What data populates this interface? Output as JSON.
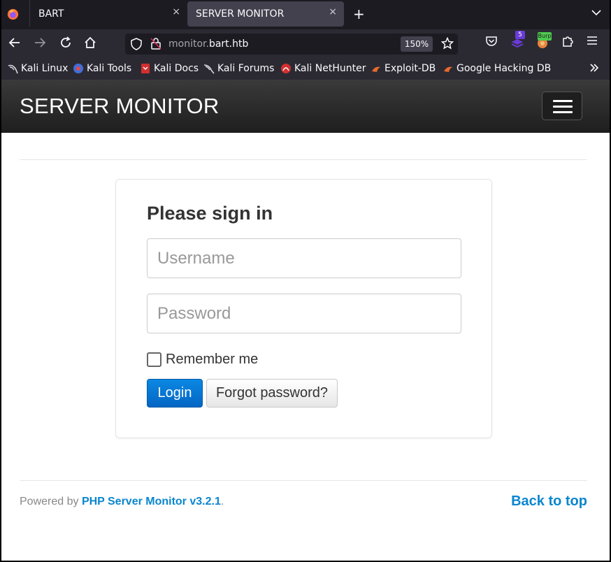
{
  "browser": {
    "tabs": [
      {
        "label": "BART",
        "close": "×"
      },
      {
        "label": "SERVER MONITOR",
        "close": "×"
      }
    ],
    "new_tab": "+",
    "url_prefix": "monitor.",
    "url_domain": "bart.htb",
    "zoom": "150%",
    "ext_badge_count": "5",
    "ext_burp_label": "Burp",
    "bookmarks": [
      {
        "label": "Kali Linux",
        "icon": "kali-dragon-icon"
      },
      {
        "label": "Kali Tools",
        "icon": "kali-tools-icon"
      },
      {
        "label": "Kali Docs",
        "icon": "kali-docs-icon"
      },
      {
        "label": "Kali Forums",
        "icon": "kali-forums-icon"
      },
      {
        "label": "Kali NetHunter",
        "icon": "nethunter-icon"
      },
      {
        "label": "Exploit-DB",
        "icon": "exploitdb-icon"
      },
      {
        "label": "Google Hacking DB",
        "icon": "ghdb-icon"
      }
    ]
  },
  "app": {
    "brand": "SERVER MONITOR"
  },
  "login": {
    "title": "Please sign in",
    "username_placeholder": "Username",
    "password_placeholder": "Password",
    "remember_label": "Remember me",
    "login_button": "Login",
    "forgot_button": "Forgot password?"
  },
  "footer": {
    "powered_by": "Powered by ",
    "link": "PHP Server Monitor v3.2.1",
    "period": ".",
    "back_to_top": "Back to top"
  },
  "colors": {
    "accent": "#0a86d0",
    "login_button": "#0465c4"
  }
}
